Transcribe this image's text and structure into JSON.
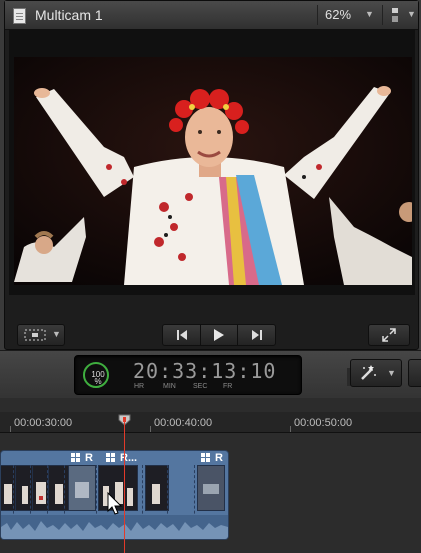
{
  "viewer": {
    "title": "Multicam 1",
    "zoom_label": "62%"
  },
  "timecode": {
    "percent_label": "100",
    "percent_sign": "%",
    "value": "20:33:13:10",
    "labels": [
      "HR",
      "MIN",
      "SEC",
      "FR"
    ]
  },
  "timeline": {
    "ruler_labels": [
      "00:00:30:00",
      "00:00:40:00",
      "00:00:50:00"
    ],
    "clip_labels": [
      "R",
      "R..."
    ],
    "edge_letter": "R"
  },
  "icons": {
    "document": "document-icon",
    "zoom_caret": "chevron-down-icon",
    "view_options": "view-options-icon",
    "frame_select": "frame-select-icon",
    "skip_back": "skip-back-icon",
    "play": "play-icon",
    "skip_forward": "skip-forward-icon",
    "fullscreen": "fullscreen-icon",
    "magic_wand": "magic-wand-icon",
    "angle": "angle-grid-icon",
    "playhead": "playhead-icon",
    "cursor": "arrow-cursor-icon"
  },
  "colors": {
    "playhead": "#e23a2a",
    "clip": "#5476a0",
    "percent_ring": "#3fae3f"
  }
}
